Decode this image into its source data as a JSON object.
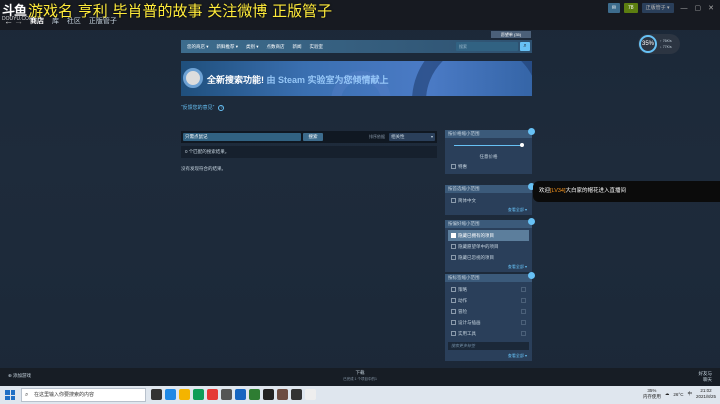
{
  "stream": {
    "logo": "斗鱼",
    "logo_sub": "DOUYU.COM",
    "overlay_title": "游戏名 亨利 毕肖普的故事  关注微博    正版管子"
  },
  "steam_nav": {
    "back": "←",
    "forward": "→",
    "links": [
      "商店",
      "库",
      "社区",
      "正版管子"
    ]
  },
  "top_right": {
    "mail": "✉",
    "badge": "78",
    "account_label": "正版管子 ▾",
    "minimize": "—",
    "restore": "▢",
    "close": "✕"
  },
  "store": {
    "wishlist": "愿望单 (35)",
    "nav": [
      "您的商店 ▾",
      "新鲜推荐 ▾",
      "类别 ▾",
      "点数商店",
      "新闻",
      "实验室"
    ],
    "search_placeholder": "搜索",
    "search_icon": "⌕"
  },
  "banner": {
    "main": "全新搜索功能!",
    "dim": " 由 Steam 实验室为您倾情献上"
  },
  "feedback": {
    "label": "“反馈您的意见”",
    "q": "?"
  },
  "search_row": {
    "value": "只需点鼠记",
    "button": "搜索",
    "sort_label": "排序依据",
    "sort_value": "相关性",
    "sort_chev": "▾"
  },
  "results": {
    "count": "0 个匹配的搜索结果。",
    "none": "没有发现符合的结果。"
  },
  "panel_price": {
    "title": "按价格缩小范围",
    "price": "任意价格",
    "rows": [
      "特惠"
    ]
  },
  "panel_lang": {
    "title": "按首选缩小范围",
    "rows": [
      "简体中文"
    ],
    "more": "查看全部 ▾"
  },
  "panel_prefs": {
    "title": "按偏好缩小范围",
    "rows": [
      "隐藏已拥有的项目",
      "隐藏愿望单中的项目",
      "隐藏已忽视的项目"
    ],
    "more": "查看全部 ▾"
  },
  "panel_tags": {
    "title": "按标签缩小范围",
    "rows": [
      "策略",
      "动作",
      "冒险",
      "设计与插画",
      "实用工具"
    ],
    "search": "搜索更多标签",
    "more": "查看全部 ▾"
  },
  "cpu": {
    "percent": "35%",
    "line1": "↑ 76K/s",
    "line2": "↓ 77K/s"
  },
  "toast": {
    "pre": "欢迎",
    "lv": "[LV34]",
    "post": "大白家的帽花进入直播间"
  },
  "steambar": {
    "add_game": "添加游戏",
    "dl_title": "下载",
    "dl_sub": "已完成 1 个项目中的1",
    "friends_1": "好友与",
    "friends_2": "聊天"
  },
  "taskbar": {
    "search_placeholder": "在这里输入你要搜索的内容",
    "search_icon": "⌕",
    "mem_1": "35%",
    "mem_2": "内存使用",
    "weather": "26°C",
    "lang": "中",
    "time": "21:02",
    "date": "2021/8/25"
  },
  "colors": {
    "accent": "#67c1f5",
    "bg": "#1b2838"
  }
}
